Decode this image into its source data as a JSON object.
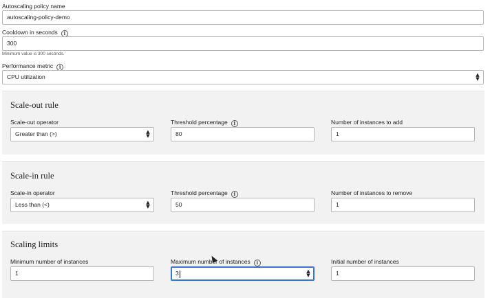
{
  "policy_name": {
    "label": "Autoscaling policy name",
    "value": "autoscaling-policy-demo"
  },
  "cooldown": {
    "label": "Cooldown in seconds",
    "value": "300",
    "hint": "Minimum value is 300 seconds."
  },
  "metric": {
    "label": "Performance metric",
    "selected": "CPU utilization"
  },
  "scale_out": {
    "title": "Scale-out rule",
    "operator_label": "Scale-out operator",
    "operator_value": "Greater than (>)",
    "threshold_label": "Threshold percentage",
    "threshold_value": "80",
    "instances_label": "Number of instances to add",
    "instances_value": "1"
  },
  "scale_in": {
    "title": "Scale-in rule",
    "operator_label": "Scale-in operator",
    "operator_value": "Less than (<)",
    "threshold_label": "Threshold percentage",
    "threshold_value": "50",
    "instances_label": "Number of instances to remove",
    "instances_value": "1"
  },
  "limits": {
    "title": "Scaling limits",
    "min_label": "Minimum number of instances",
    "min_value": "1",
    "max_label": "Maximum number of instances",
    "max_value": "3",
    "initial_label": "Initial number of instances",
    "initial_value": "1"
  },
  "icons": {
    "info": "info-icon",
    "select_caret": "select-caret-icon",
    "stepper": "stepper-icon"
  },
  "colors": {
    "focus": "#3b73d1",
    "panel_bg": "#f2f2f2"
  }
}
